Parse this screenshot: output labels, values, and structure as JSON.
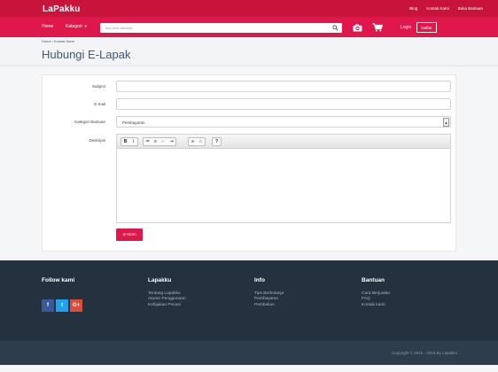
{
  "header": {
    "logo": "LaPakku",
    "top_links": [
      "Blog",
      "Kontak Kami",
      "Buka Bantuan"
    ]
  },
  "nav": {
    "home": "Home",
    "kategori": "Kategori",
    "search_placeholder": "Aku mau belanja...",
    "login": "Login",
    "daftar": "Daftar"
  },
  "breadcrumb": "Home / Kontak Kami",
  "page_title": "Hubungi E-Lapak",
  "form": {
    "subject_label": "Subject",
    "subject_value": "",
    "email_label": "E-mail",
    "email_value": "",
    "kategori_label": "Kategori Bantuan",
    "kategori_value": "Pembayaran",
    "deskripsi_label": "Deskripsi",
    "toolbar": [
      "B",
      "I",
      "≔",
      "≡",
      "⇤",
      "⇥",
      "∞",
      "⊘",
      "?"
    ],
    "send_label": "⊜ Kirim"
  },
  "footer": {
    "follow_title": "Follow kami",
    "social": [
      "f",
      "t",
      "G+"
    ],
    "columns": [
      {
        "title": "Lapakku",
        "links": [
          "Tentang Lapakku",
          "Aturan Penggunaan",
          "Kebijakan Privasi"
        ]
      },
      {
        "title": "Info",
        "links": [
          "Tips Berbelanja",
          "Pembayaran",
          "Pembelian"
        ]
      },
      {
        "title": "Bantuan",
        "links": [
          "Cara Berjualan",
          "FAQ",
          "Kontak kami"
        ]
      }
    ],
    "copyright": "Copyright © 2015 - 2019 By Lapakku"
  },
  "colors": {
    "brand_dark": "#c8143a",
    "brand": "#e0174a",
    "footer_bg": "#243240",
    "facebook": "#3b5998",
    "twitter": "#1da1f2",
    "google": "#dd4b39"
  }
}
